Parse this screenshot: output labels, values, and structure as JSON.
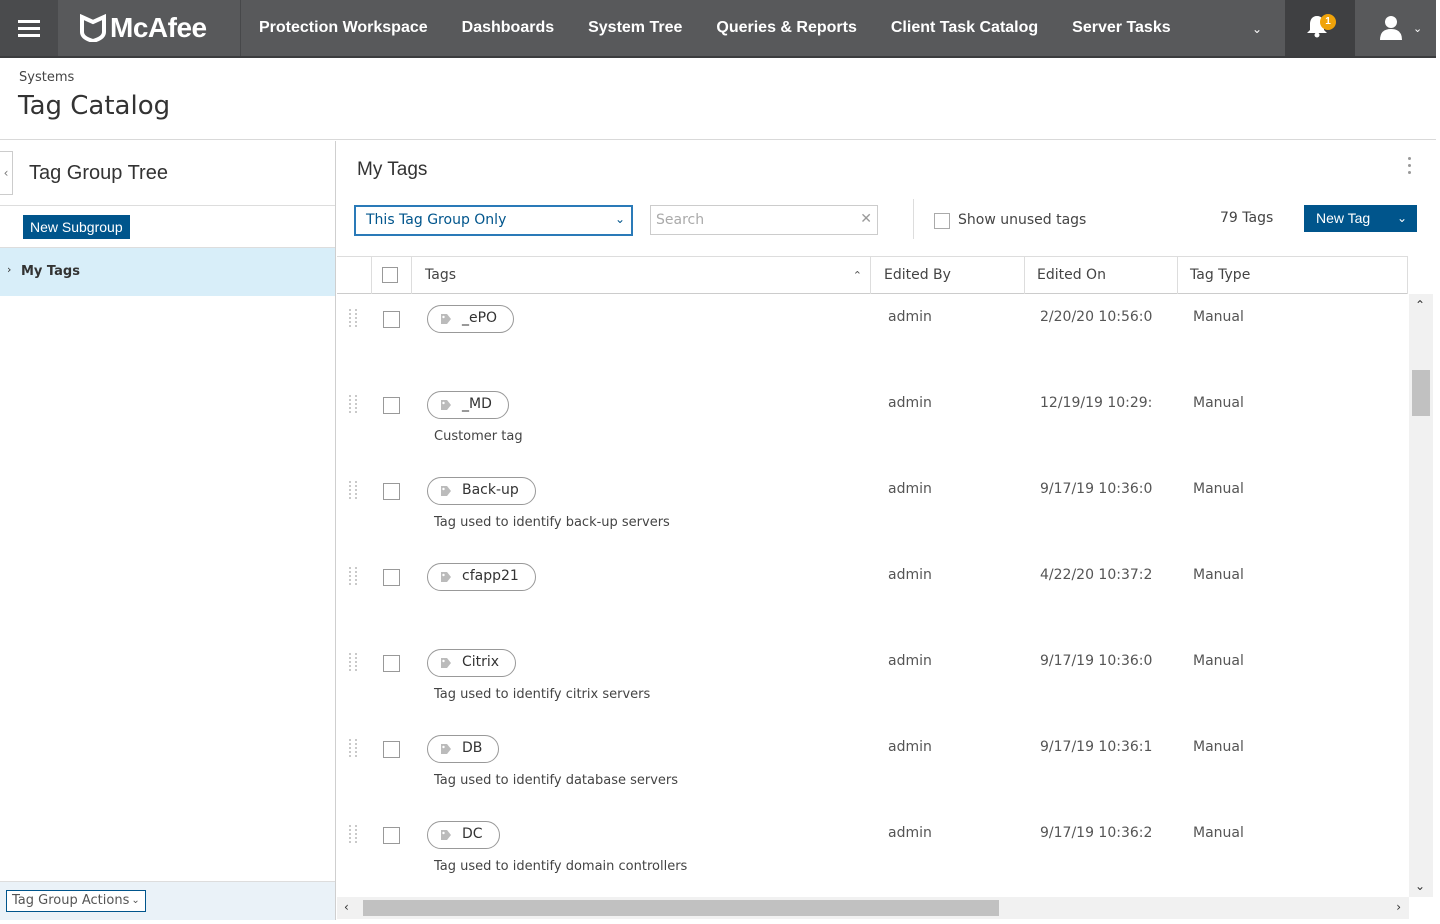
{
  "nav": {
    "brand": "McAfee",
    "links": [
      "Protection Workspace",
      "Dashboards",
      "System Tree",
      "Queries & Reports",
      "Client Task Catalog",
      "Server Tasks"
    ],
    "notification_count": "1",
    "icons": [
      "hamburger-icon",
      "bell-icon",
      "user-icon",
      "chevron-down-icon"
    ]
  },
  "header": {
    "breadcrumb": "Systems",
    "title": "Tag Catalog"
  },
  "left_panel": {
    "title": "Tag Group Tree",
    "new_subgroup_label": "New Subgroup",
    "tree": [
      {
        "label": "My Tags",
        "selected": true
      }
    ],
    "footer_action_label": "Tag Group Actions"
  },
  "main": {
    "title": "My Tags",
    "scope_select": "This Tag Group Only",
    "search_placeholder": "Search",
    "show_unused_label": "Show unused tags",
    "tag_count": "79 Tags",
    "new_tag_label": "New Tag",
    "columns": {
      "tags": "Tags",
      "edited_by": "Edited By",
      "edited_on": "Edited On",
      "tag_type": "Tag Type"
    },
    "rows": [
      {
        "name": "_ePO",
        "description": "",
        "edited_by": "admin",
        "edited_on": "2/20/20 10:56:0",
        "type": "Manual"
      },
      {
        "name": "_MD",
        "description": "Customer tag",
        "edited_by": "admin",
        "edited_on": "12/19/19 10:29:",
        "type": "Manual"
      },
      {
        "name": "Back-up",
        "description": "Tag used to identify back-up servers",
        "edited_by": "admin",
        "edited_on": "9/17/19 10:36:0",
        "type": "Manual"
      },
      {
        "name": "cfapp21",
        "description": "",
        "edited_by": "admin",
        "edited_on": "4/22/20 10:37:2",
        "type": "Manual"
      },
      {
        "name": "Citrix",
        "description": "Tag used to identify citrix servers",
        "edited_by": "admin",
        "edited_on": "9/17/19 10:36:0",
        "type": "Manual"
      },
      {
        "name": "DB",
        "description": "Tag used to identify database servers",
        "edited_by": "admin",
        "edited_on": "9/17/19 10:36:1",
        "type": "Manual"
      },
      {
        "name": "DC",
        "description": "Tag used to identify domain controllers",
        "edited_by": "admin",
        "edited_on": "9/17/19 10:36:2",
        "type": "Manual"
      }
    ]
  },
  "colors": {
    "nav_bg": "#58595b",
    "primary": "#00558c",
    "selected_row": "#d8eef9",
    "badge": "#f0a30a"
  }
}
